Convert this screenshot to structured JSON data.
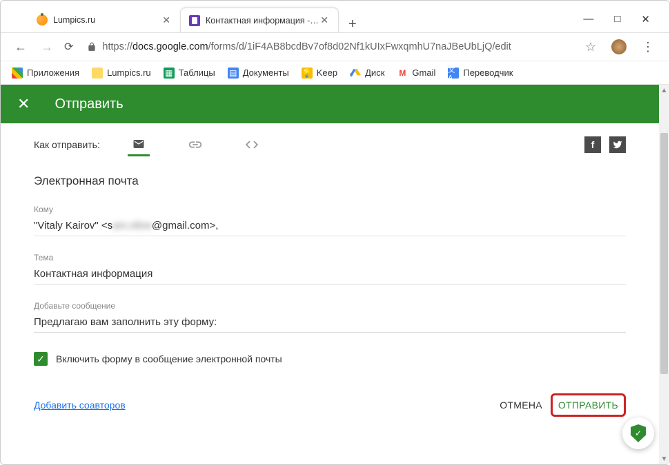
{
  "window": {
    "tabs": [
      {
        "title": "Lumpics.ru"
      },
      {
        "title": "Контактная информация - Goo"
      }
    ]
  },
  "url": {
    "scheme": "https://",
    "host": "docs.google.com",
    "path": "/forms/d/1iF4AB8bcdBv7of8d02Nf1kUIxFwxqmhU7naJBeUbLjQ/edit"
  },
  "bookmarks": {
    "apps": "Приложения",
    "lumpics": "Lumpics.ru",
    "sheets": "Таблицы",
    "docs": "Документы",
    "keep": "Keep",
    "drive": "Диск",
    "gmail": "Gmail",
    "translate": "Переводчик"
  },
  "dialog": {
    "title": "Отправить",
    "send_via_label": "Как отправить:",
    "email_section": "Электронная почта",
    "to_label": "Кому",
    "to_value_prefix": "\"Vitaly Kairov\" <s",
    "to_value_blur": "am.nline",
    "to_value_suffix": "@gmail.com>,",
    "subject_label": "Тема",
    "subject_value": "Контактная информация",
    "message_label": "Добавьте сообщение",
    "message_value": "Предлагаю вам заполнить эту форму:",
    "include_form_label": "Включить форму в сообщение электронной почты",
    "add_collaborators": "Добавить соавторов",
    "cancel": "ОТМЕНА",
    "submit": "ОТПРАВИТЬ"
  }
}
